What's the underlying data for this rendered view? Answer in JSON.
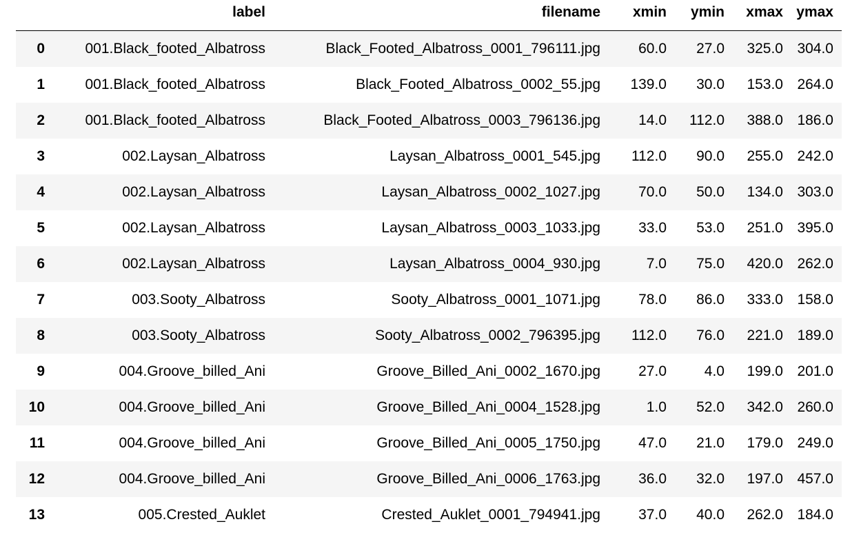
{
  "columns": {
    "index": "",
    "label": "label",
    "filename": "filename",
    "xmin": "xmin",
    "ymin": "ymin",
    "xmax": "xmax",
    "ymax": "ymax"
  },
  "rows": [
    {
      "index": "0",
      "label": "001.Black_footed_Albatross",
      "filename": "Black_Footed_Albatross_0001_796111.jpg",
      "xmin": "60.0",
      "ymin": "27.0",
      "xmax": "325.0",
      "ymax": "304.0"
    },
    {
      "index": "1",
      "label": "001.Black_footed_Albatross",
      "filename": "Black_Footed_Albatross_0002_55.jpg",
      "xmin": "139.0",
      "ymin": "30.0",
      "xmax": "153.0",
      "ymax": "264.0"
    },
    {
      "index": "2",
      "label": "001.Black_footed_Albatross",
      "filename": "Black_Footed_Albatross_0003_796136.jpg",
      "xmin": "14.0",
      "ymin": "112.0",
      "xmax": "388.0",
      "ymax": "186.0"
    },
    {
      "index": "3",
      "label": "002.Laysan_Albatross",
      "filename": "Laysan_Albatross_0001_545.jpg",
      "xmin": "112.0",
      "ymin": "90.0",
      "xmax": "255.0",
      "ymax": "242.0"
    },
    {
      "index": "4",
      "label": "002.Laysan_Albatross",
      "filename": "Laysan_Albatross_0002_1027.jpg",
      "xmin": "70.0",
      "ymin": "50.0",
      "xmax": "134.0",
      "ymax": "303.0"
    },
    {
      "index": "5",
      "label": "002.Laysan_Albatross",
      "filename": "Laysan_Albatross_0003_1033.jpg",
      "xmin": "33.0",
      "ymin": "53.0",
      "xmax": "251.0",
      "ymax": "395.0"
    },
    {
      "index": "6",
      "label": "002.Laysan_Albatross",
      "filename": "Laysan_Albatross_0004_930.jpg",
      "xmin": "7.0",
      "ymin": "75.0",
      "xmax": "420.0",
      "ymax": "262.0"
    },
    {
      "index": "7",
      "label": "003.Sooty_Albatross",
      "filename": "Sooty_Albatross_0001_1071.jpg",
      "xmin": "78.0",
      "ymin": "86.0",
      "xmax": "333.0",
      "ymax": "158.0"
    },
    {
      "index": "8",
      "label": "003.Sooty_Albatross",
      "filename": "Sooty_Albatross_0002_796395.jpg",
      "xmin": "112.0",
      "ymin": "76.0",
      "xmax": "221.0",
      "ymax": "189.0"
    },
    {
      "index": "9",
      "label": "004.Groove_billed_Ani",
      "filename": "Groove_Billed_Ani_0002_1670.jpg",
      "xmin": "27.0",
      "ymin": "4.0",
      "xmax": "199.0",
      "ymax": "201.0"
    },
    {
      "index": "10",
      "label": "004.Groove_billed_Ani",
      "filename": "Groove_Billed_Ani_0004_1528.jpg",
      "xmin": "1.0",
      "ymin": "52.0",
      "xmax": "342.0",
      "ymax": "260.0"
    },
    {
      "index": "11",
      "label": "004.Groove_billed_Ani",
      "filename": "Groove_Billed_Ani_0005_1750.jpg",
      "xmin": "47.0",
      "ymin": "21.0",
      "xmax": "179.0",
      "ymax": "249.0"
    },
    {
      "index": "12",
      "label": "004.Groove_billed_Ani",
      "filename": "Groove_Billed_Ani_0006_1763.jpg",
      "xmin": "36.0",
      "ymin": "32.0",
      "xmax": "197.0",
      "ymax": "457.0"
    },
    {
      "index": "13",
      "label": "005.Crested_Auklet",
      "filename": "Crested_Auklet_0001_794941.jpg",
      "xmin": "37.0",
      "ymin": "40.0",
      "xmax": "262.0",
      "ymax": "184.0"
    }
  ]
}
